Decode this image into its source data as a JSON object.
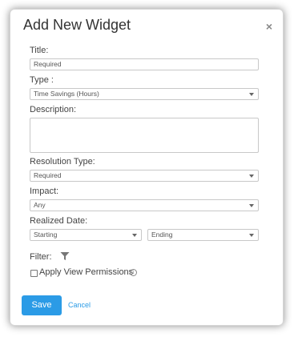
{
  "dialog": {
    "title": "Add New Widget",
    "close_icon": "×"
  },
  "form": {
    "title_label": "Title:",
    "title_placeholder": "Required",
    "type_label": "Type :",
    "type_value": "Time Savings (Hours)",
    "description_label": "Description:",
    "resolution_label": "Resolution Type:",
    "resolution_value": "Required",
    "impact_label": "Impact:",
    "impact_value": "Any",
    "realized_label": "Realized Date:",
    "starting_value": "Starting",
    "ending_value": "Ending",
    "filter_label": "Filter:",
    "filter_icon": "filter-icon",
    "apply_label": "Apply View Permissions",
    "info_icon": "i"
  },
  "actions": {
    "save_label": "Save",
    "cancel_label": "Cancel"
  },
  "colors": {
    "accent": "#2b9be6"
  }
}
